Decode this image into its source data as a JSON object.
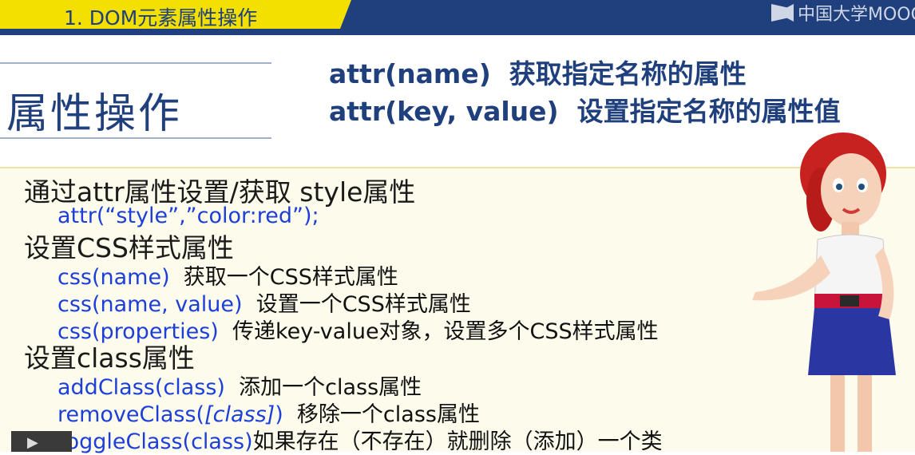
{
  "header": {
    "title": "1. DOM元素属性操作",
    "logo_text": "中国大学MOOC"
  },
  "section_title": "属性操作",
  "api_lines": [
    {
      "code": "attr(name)",
      "desc": "获取指定名称的属性"
    },
    {
      "code": "attr(key, value)",
      "desc": "设置指定名称的属性值"
    }
  ],
  "content": {
    "s1": {
      "heading_prefix": "通过",
      "heading_code": "attr",
      "heading_suffix": "属性设置/获取 style属性",
      "example": "attr(“style”,”color:red”);"
    },
    "s2": {
      "heading": "设置CSS样式属性",
      "items": [
        {
          "code": "css(name)",
          "desc": "获取一个CSS样式属性"
        },
        {
          "code": "css(name, value)",
          "desc": "设置一个CSS样式属性"
        },
        {
          "code": "css(properties)",
          "desc": "传递key-value对象，设置多个CSS样式属性"
        }
      ]
    },
    "s3": {
      "heading": "设置class属性",
      "items": [
        {
          "code": "addClass(class)",
          "desc": "添加一个class属性"
        },
        {
          "code_prefix": "removeClass(",
          "code_italic": "[class]",
          "code_suffix": ")",
          "desc": "移除一个class属性"
        },
        {
          "code": "toggleClass(class)",
          "desc": "如果存在（不存在）就删除（添加）一个类"
        }
      ]
    }
  },
  "colors": {
    "header_blue": "#1f3f7d",
    "header_yellow": "#f3df00",
    "code_blue": "#1c3fd8",
    "content_bg": "#fdfbeb"
  },
  "icons": [
    "mooc-logo-icon",
    "presenter-illustration",
    "play-icon"
  ]
}
